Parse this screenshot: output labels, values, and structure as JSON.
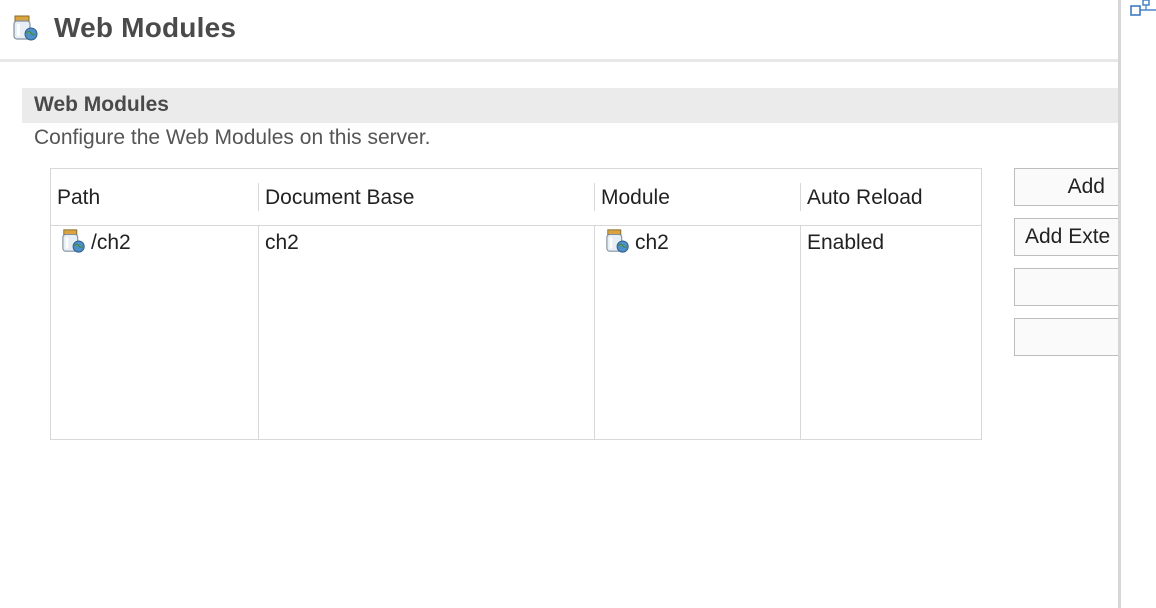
{
  "page": {
    "title": "Web Modules",
    "icon": "web-module-jar-icon"
  },
  "section": {
    "title": "Web Modules",
    "description": "Configure the Web Modules on this server."
  },
  "table": {
    "columns": [
      "Path",
      "Document Base",
      "Module",
      "Auto Reload"
    ],
    "rows": [
      {
        "path": "/ch2",
        "document_base": "ch2",
        "module": "ch2",
        "auto_reload": "Enabled"
      }
    ]
  },
  "buttons": {
    "add": "Add",
    "add_external": "Add Exte",
    "blank1": "",
    "blank2": ""
  },
  "side": {
    "icon": "outline-view-icon"
  },
  "colors": {
    "section_bar": "#ebebeb",
    "title_text": "#4a4a4a",
    "border": "#d8d8d8"
  }
}
